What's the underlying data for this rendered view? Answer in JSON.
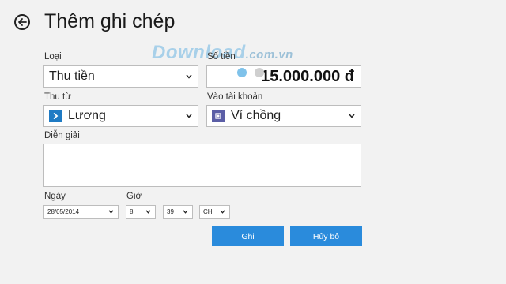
{
  "header": {
    "title": "Thêm ghi chép",
    "back_icon": "back-arrow-icon"
  },
  "watermark": {
    "main": "Download",
    "suffix": ".com.vn",
    "dot_colors": [
      "#7fc2ea",
      "#cfcfcf",
      "#d9d9d9",
      "#f4c97a",
      "#8fc0e6",
      "#e88a8a"
    ]
  },
  "form": {
    "type_label": "Loại",
    "type_value": "Thu tiền",
    "amount_label": "Số tiền",
    "amount_value": "15.000.000 đ",
    "source_label": "Thu từ",
    "source_value": "Lương",
    "account_label": "Vào tài khoản",
    "account_value": "Ví chồng",
    "desc_label": "Diễn giải",
    "desc_value": "",
    "date_label": "Ngày",
    "date_value": "28/05/2014",
    "time_label": "Giờ",
    "hour_value": "8",
    "minute_value": "39",
    "ampm_value": "CH"
  },
  "actions": {
    "save_label": "Ghi",
    "cancel_label": "Hủy bỏ"
  },
  "colors": {
    "accent": "#2a8bdc",
    "source_icon_bg": "#1f7bc4",
    "account_icon_bg": "#5b5ea6"
  }
}
